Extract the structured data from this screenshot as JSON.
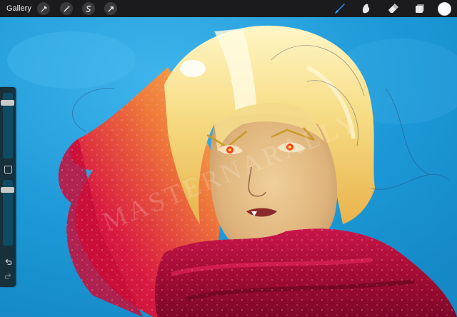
{
  "toolbar": {
    "gallery_label": "Gallery",
    "left_tools": [
      {
        "icon": "wrench-icon",
        "name": "actions"
      },
      {
        "icon": "magic-wand-icon",
        "name": "adjustments"
      },
      {
        "icon": "selection-icon",
        "name": "selection"
      },
      {
        "icon": "arrow-cursor-icon",
        "name": "transform"
      }
    ],
    "right_tools": [
      {
        "icon": "brush-icon",
        "name": "paint",
        "active": true
      },
      {
        "icon": "smudge-icon",
        "name": "smudge",
        "active": false
      },
      {
        "icon": "eraser-icon",
        "name": "eraser",
        "active": false
      },
      {
        "icon": "layers-icon",
        "name": "layers",
        "active": false
      }
    ],
    "current_color": "#ffffff",
    "active_color": "#2f8fff"
  },
  "sidebar": {
    "brush_size_level": 0.12,
    "brush_opacity_level": 0.12,
    "modify_icon": "square-icon",
    "undo_icon": "undo-icon",
    "redo_icon": "redo-icon"
  },
  "canvas": {
    "watermark_text": "MASTERNARALLY",
    "background_color": "#1f9bd8",
    "hair_color": "#f7e7a0",
    "hair_tip_color": "#d0123c",
    "skin_color": "#e8c790",
    "scarf_color": "#b0103a",
    "eye_color": "#ff3a10"
  }
}
